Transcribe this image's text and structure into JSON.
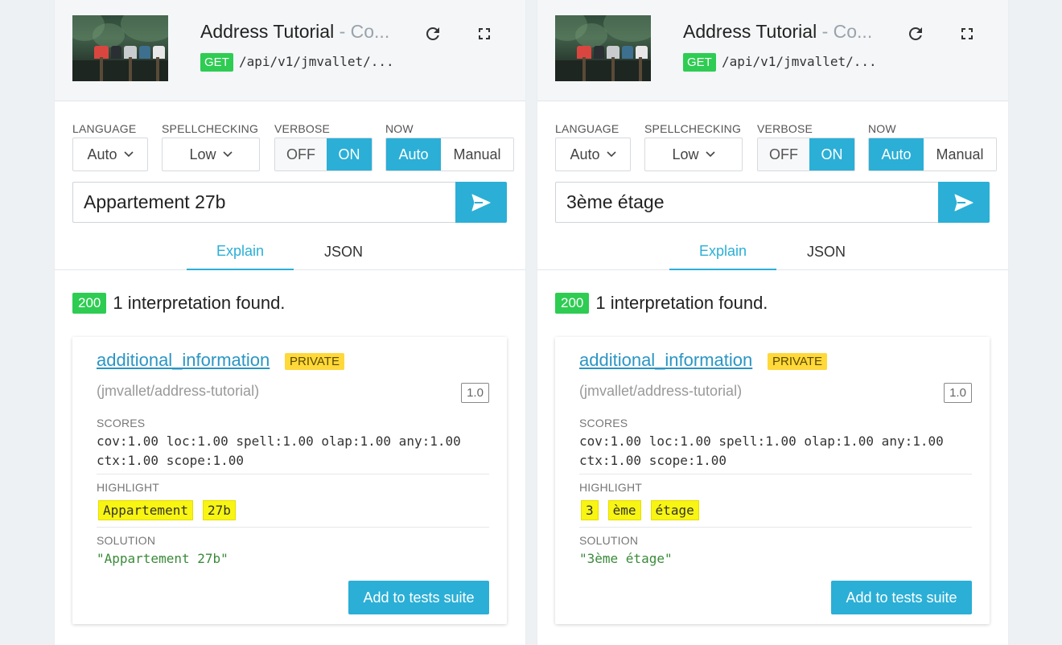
{
  "panels": [
    {
      "header": {
        "title": "Address Tutorial",
        "title_suffix": " - Co...",
        "method": "GET",
        "path": "/api/v1/jmvallet/..."
      },
      "controls": {
        "language": {
          "label": "LANGUAGE",
          "value": "Auto"
        },
        "spellchecking": {
          "label": "SPELLCHECKING",
          "value": "Low"
        },
        "verbose": {
          "label": "VERBOSE",
          "options": [
            "OFF",
            "ON"
          ],
          "selected": "ON"
        },
        "now": {
          "label": "NOW",
          "options": [
            "Auto",
            "Manual"
          ],
          "selected": "Auto"
        }
      },
      "query": "Appartement 27b",
      "tabs": [
        "Explain",
        "JSON"
      ],
      "active_tab": "Explain",
      "status_code": "200",
      "status_message": "1 interpretation found.",
      "card": {
        "intent": "additional_information",
        "badge": "PRIVATE",
        "owner": "(jmvallet/address-tutorial)",
        "version": "1.0",
        "scores_label": "SCORES",
        "scores_line1": "cov:1.00 loc:1.00 spell:1.00 olap:1.00 any:1.00",
        "scores_line2": "ctx:1.00 scope:1.00",
        "highlight_label": "HIGHLIGHT",
        "highlights": [
          "Appartement",
          "27b"
        ],
        "solution_label": "SOLUTION",
        "solution": "\"Appartement 27b\"",
        "add_button": "Add to tests suite"
      }
    },
    {
      "header": {
        "title": "Address Tutorial",
        "title_suffix": " - Co...",
        "method": "GET",
        "path": "/api/v1/jmvallet/..."
      },
      "controls": {
        "language": {
          "label": "LANGUAGE",
          "value": "Auto"
        },
        "spellchecking": {
          "label": "SPELLCHECKING",
          "value": "Low"
        },
        "verbose": {
          "label": "VERBOSE",
          "options": [
            "OFF",
            "ON"
          ],
          "selected": "ON"
        },
        "now": {
          "label": "NOW",
          "options": [
            "Auto",
            "Manual"
          ],
          "selected": "Auto"
        }
      },
      "query": "3ème étage",
      "tabs": [
        "Explain",
        "JSON"
      ],
      "active_tab": "Explain",
      "status_code": "200",
      "status_message": "1 interpretation found.",
      "card": {
        "intent": "additional_information",
        "badge": "PRIVATE",
        "owner": "(jmvallet/address-tutorial)",
        "version": "1.0",
        "scores_label": "SCORES",
        "scores_line1": "cov:1.00 loc:1.00 spell:1.00 olap:1.00 any:1.00",
        "scores_line2": "ctx:1.00 scope:1.00",
        "highlight_label": "HIGHLIGHT",
        "highlights": [
          "3",
          "ème",
          "étage"
        ],
        "solution_label": "SOLUTION",
        "solution": "\"3ème étage\"",
        "add_button": "Add to tests suite"
      }
    }
  ],
  "colors": {
    "accent": "#2bafd6",
    "success": "#2ecc52",
    "private_badge": "#ffd83a",
    "highlight": "#f8f512",
    "solution_text": "#3a8a3a",
    "link": "#2a95c4"
  },
  "icons": [
    "refresh-icon",
    "fullscreen-icon",
    "chevron-down-icon",
    "send-icon"
  ]
}
